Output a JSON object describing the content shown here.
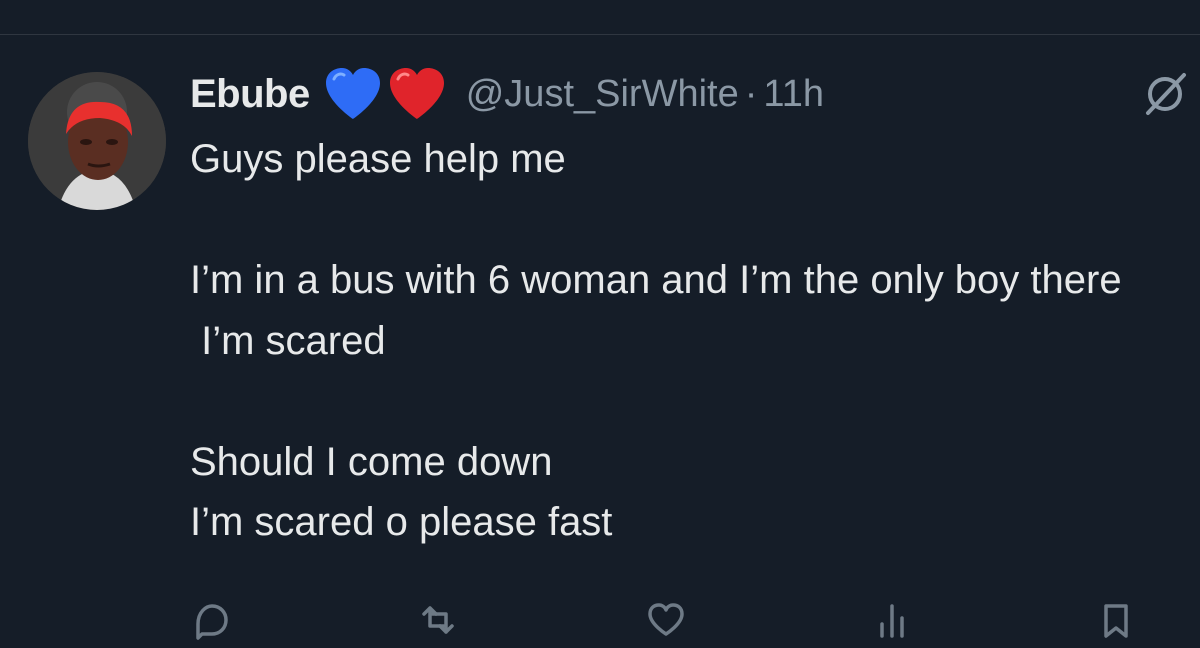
{
  "tweet": {
    "display_name": "Ebube",
    "badges": [
      "blue-heart-icon",
      "red-heart-icon"
    ],
    "handle": "@Just_SirWhite",
    "separator": "·",
    "time": "11h",
    "text": "Guys please help me\n\nI’m in a bus with 6 woman and I’m the only boy there\n I’m scared\n\nShould I come down\nI’m scared o please fast"
  },
  "actions": {
    "reply_icon": "reply-icon",
    "retweet_icon": "retweet-icon",
    "like_icon": "like-icon",
    "views_icon": "views-icon",
    "bookmark_icon": "bookmark-icon"
  },
  "colors": {
    "background": "#151d28",
    "text": "#e7e9ea",
    "secondary_text": "#8b98a5",
    "blue_heart": "#2e6cf6",
    "red_heart": "#e0242b",
    "hair": "#e8302e"
  }
}
